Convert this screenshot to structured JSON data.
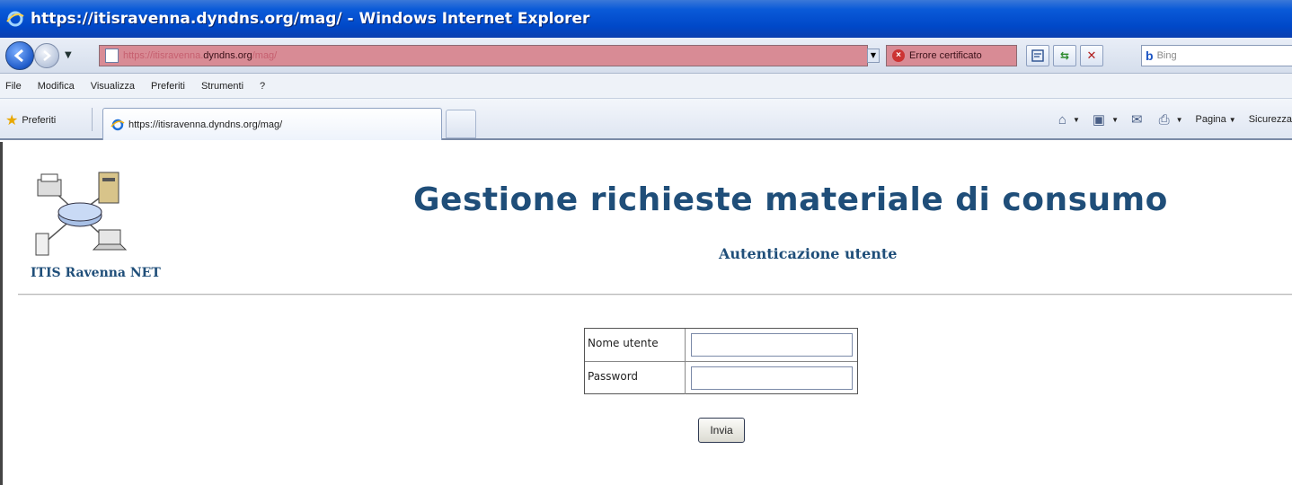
{
  "window": {
    "title": "https://itisravenna.dyndns.org/mag/ - Windows Internet Explorer"
  },
  "address_bar": {
    "url_prefix": "https://itisravenna.",
    "url_host": "dyndns.org",
    "url_suffix": "/mag/",
    "certificate_error": "Errore certificato",
    "state_color": "#d88b95"
  },
  "search": {
    "placeholder": "Bing",
    "provider_icon": "bing-icon"
  },
  "menu": {
    "items": [
      {
        "label": "File",
        "accel": "F"
      },
      {
        "label": "Modifica",
        "accel": "M"
      },
      {
        "label": "Visualizza",
        "accel": "V"
      },
      {
        "label": "Preferiti",
        "accel": "r"
      },
      {
        "label": "Strumenti",
        "accel": "e"
      },
      {
        "label": "?",
        "accel": "?"
      }
    ]
  },
  "favorites_bar": {
    "favorites_label": "Preferiti",
    "active_tab_label": "https://itisravenna.dyndns.org/mag/"
  },
  "command_bar": {
    "home_icon": "home-icon",
    "feeds_icon": "feeds-icon",
    "mail_icon": "mail-icon",
    "print_icon": "print-icon",
    "page_label": "Pagina",
    "safety_label": "Sicurezza"
  },
  "page": {
    "logo_caption": "ITIS Ravenna NET",
    "title": "Gestione richieste materiale di consumo",
    "subtitle": "Autenticazione utente",
    "accent_color": "#1f4e79",
    "form": {
      "username_label": "Nome utente",
      "username_value": "",
      "password_label": "Password",
      "password_value": "",
      "submit_label": "Invia"
    }
  }
}
